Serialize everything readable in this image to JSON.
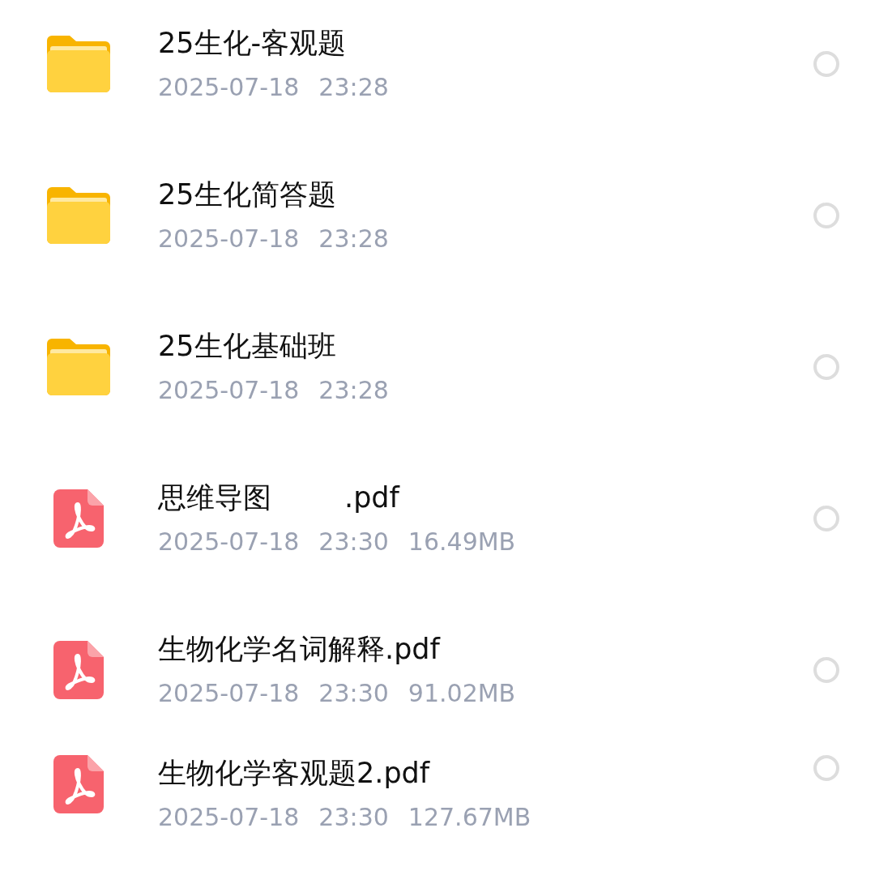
{
  "files": [
    {
      "kind": "folder",
      "name_parts": [
        "25生化-客观题"
      ],
      "date": "2025-07-18",
      "time": "23:28",
      "selected": false
    },
    {
      "kind": "folder",
      "name_parts": [
        "25生化简答题"
      ],
      "date": "2025-07-18",
      "time": "23:28",
      "selected": false
    },
    {
      "kind": "folder",
      "name_parts": [
        "25生化基础班"
      ],
      "date": "2025-07-18",
      "time": "23:28",
      "selected": false
    },
    {
      "kind": "pdf",
      "name_parts": [
        "思维导图",
        ".pdf"
      ],
      "date": "2025-07-18",
      "time": "23:30",
      "size": "16.49MB",
      "selected": false
    },
    {
      "kind": "pdf",
      "name_parts": [
        "生物化学名词解释.pdf"
      ],
      "date": "2025-07-18",
      "time": "23:30",
      "size": "91.02MB",
      "selected": false
    },
    {
      "kind": "pdf",
      "name_parts": [
        "生物化学客观题2.pdf"
      ],
      "date": "2025-07-18",
      "time": "23:30",
      "size": "127.67MB",
      "selected": false
    }
  ]
}
